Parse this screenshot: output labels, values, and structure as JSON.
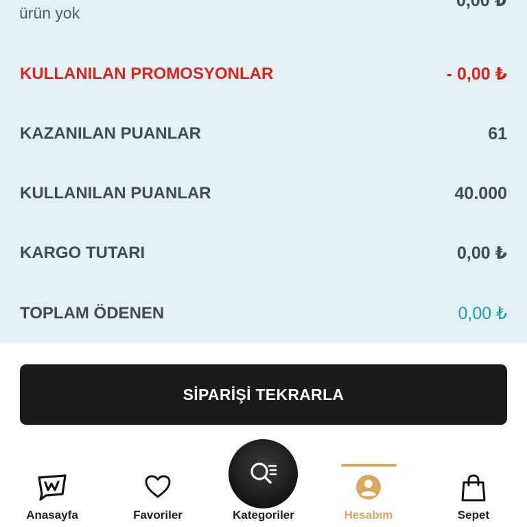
{
  "summary": {
    "partial_top_value": "0,00 ₺",
    "partial_top_label": "ürün yok",
    "rows": [
      {
        "label": "KULLANILAN PROMOSYONLAR",
        "value": "- 0,00 ₺"
      },
      {
        "label": "KAZANILAN PUANLAR",
        "value": "61"
      },
      {
        "label": "KULLANILAN PUANLAR",
        "value": "40.000"
      },
      {
        "label": "KARGO TUTARI",
        "value": "0,00 ₺"
      },
      {
        "label": "TOPLAM ÖDENEN",
        "value": "0,00 ₺"
      }
    ]
  },
  "actions": {
    "reorder_label": "SİPARİŞİ TEKRARLA"
  },
  "nav": {
    "items": [
      {
        "label": "Anasayfa",
        "icon": "home-w-icon"
      },
      {
        "label": "Favoriler",
        "icon": "heart-icon"
      },
      {
        "label": "Kategoriler",
        "icon": "search-list-icon"
      },
      {
        "label": "Hesabım",
        "icon": "user-icon",
        "active": true
      },
      {
        "label": "Sepet",
        "icon": "bag-icon"
      }
    ]
  },
  "colors": {
    "summary_bg": "#e3f1f5",
    "promo_red": "#d8261f",
    "total_teal": "#1d9ab0",
    "active_gold": "#d9a85f",
    "cta_bg": "#1b1b1b"
  }
}
